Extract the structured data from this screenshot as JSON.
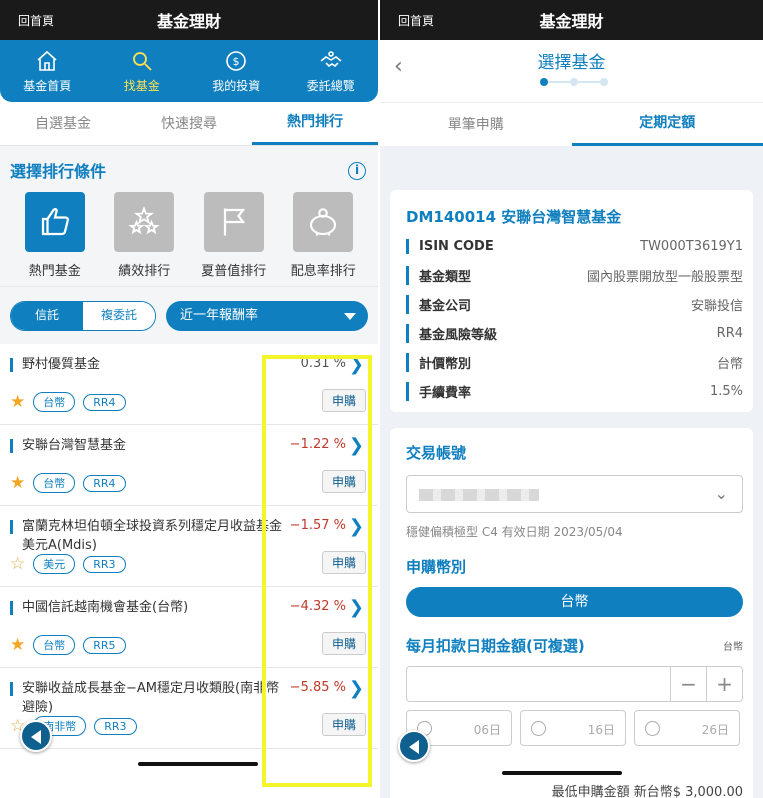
{
  "left": {
    "statusbar": {
      "back": "回首頁",
      "title": "基金理財"
    },
    "topnav": [
      {
        "label": "基金首頁",
        "icon": "home-icon",
        "active": false
      },
      {
        "label": "找基金",
        "icon": "search-icon",
        "active": true
      },
      {
        "label": "我的投資",
        "icon": "coin-icon",
        "active": false
      },
      {
        "label": "委託總覽",
        "icon": "handshake-icon",
        "active": false
      }
    ],
    "tabs": [
      {
        "label": "自選基金",
        "active": false
      },
      {
        "label": "快速搜尋",
        "active": false
      },
      {
        "label": "熱門排行",
        "active": true
      }
    ],
    "criteria": {
      "title": "選擇排行條件",
      "items": [
        {
          "label": "熱門基金",
          "icon": "thumbs-up-icon",
          "active": true
        },
        {
          "label": "績效排行",
          "icon": "stars-icon",
          "active": false
        },
        {
          "label": "夏普值排行",
          "icon": "flag-icon",
          "active": false
        },
        {
          "label": "配息率排行",
          "icon": "piggy-bank-icon",
          "active": false
        }
      ]
    },
    "filters": {
      "segments": [
        {
          "label": "信託",
          "active": true
        },
        {
          "label": "複委託",
          "active": false
        }
      ],
      "dropdown": "近一年報酬率"
    },
    "funds": [
      {
        "name": "野村優質基金",
        "rate": "0.31 %",
        "positive": true,
        "currency": "台幣",
        "risk": "RR4",
        "starred": true,
        "buy": "申購"
      },
      {
        "name": "安聯台灣智慧基金",
        "rate": "−1.22 %",
        "positive": false,
        "currency": "台幣",
        "risk": "RR4",
        "starred": true,
        "buy": "申購"
      },
      {
        "name": "富蘭克林坦伯頓全球投資系列穩定月收益基金美元A(Mdis)",
        "rate": "−1.57 %",
        "positive": false,
        "currency": "美元",
        "risk": "RR3",
        "starred": false,
        "buy": "申購"
      },
      {
        "name": "中國信託越南機會基金(台幣)",
        "rate": "−4.32 %",
        "positive": false,
        "currency": "台幣",
        "risk": "RR5",
        "starred": true,
        "buy": "申購"
      },
      {
        "name": "安聯收益成長基金−AM穩定月收類股(南非幣避險)",
        "rate": "−5.85 %",
        "positive": false,
        "currency": "南非幣",
        "risk": "RR3",
        "starred": false,
        "buy": "申購"
      }
    ]
  },
  "right": {
    "statusbar": {
      "back": "回首頁",
      "title": "基金理財"
    },
    "header": {
      "title": "選擇基金"
    },
    "tabs": [
      {
        "label": "單筆申購",
        "active": false
      },
      {
        "label": "定期定額",
        "active": true
      }
    ],
    "fund": {
      "name": "DM140014 安聯台灣智慧基金",
      "rows": [
        {
          "k": "ISIN CODE",
          "v": "TW000T3619Y1"
        },
        {
          "k": "基金類型",
          "v": "國內股票開放型一般股票型"
        },
        {
          "k": "基金公司",
          "v": "安聯投信"
        },
        {
          "k": "基金風險等級",
          "v": "RR4"
        },
        {
          "k": "計價幣別",
          "v": "台幣"
        },
        {
          "k": "手續費率",
          "v": "1.5%"
        }
      ]
    },
    "form": {
      "account_title": "交易帳號",
      "account_note": "穩健偏積極型 C4 有效日期 2023/05/04",
      "currency_title": "申購幣別",
      "currency_value": "台幣",
      "amount_title": "每月扣款日期金額(可複選)",
      "amount_unit": "台幣",
      "minus": "−",
      "plus": "+",
      "days": [
        "06日",
        "16日",
        "26日"
      ],
      "min_amount": "最低申購金額 新台幣$ 3,000.00"
    }
  }
}
